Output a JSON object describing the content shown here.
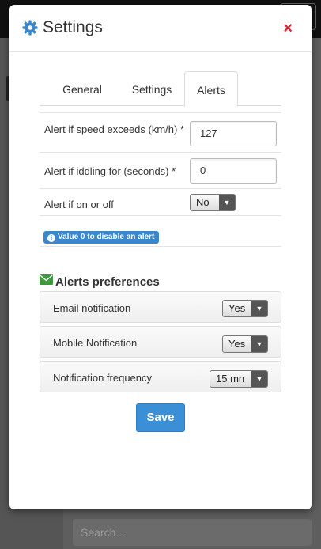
{
  "background": {
    "search_placeholder": "Search..."
  },
  "modal": {
    "title": "Settings",
    "close": "×",
    "tabs": [
      {
        "label": "General"
      },
      {
        "label": "Settings"
      },
      {
        "label": "Alerts",
        "active": true
      }
    ],
    "fields": {
      "speed": {
        "label": "Alert if speed exceeds (km/h) *",
        "value": "127"
      },
      "idle": {
        "label": "Alert if iddling for (seconds) *",
        "value": "0"
      },
      "onoff": {
        "label": "Alert if on or off",
        "value": "No"
      }
    },
    "info": "Value 0 to disable an alert",
    "preferences": {
      "title": "Alerts preferences",
      "items": [
        {
          "label": "Email notification",
          "value": "Yes"
        },
        {
          "label": "Mobile Notification",
          "value": "Yes"
        },
        {
          "label": "Notification frequency",
          "value": "15 mn"
        }
      ]
    },
    "save_label": "Save"
  },
  "colors": {
    "accent": "#3b8fd6",
    "close": "#d9242d",
    "envelope": "#3c9a3c"
  },
  "icons": [
    "gear-icon",
    "close-icon",
    "info-icon",
    "envelope-icon",
    "chevron-down-icon"
  ]
}
